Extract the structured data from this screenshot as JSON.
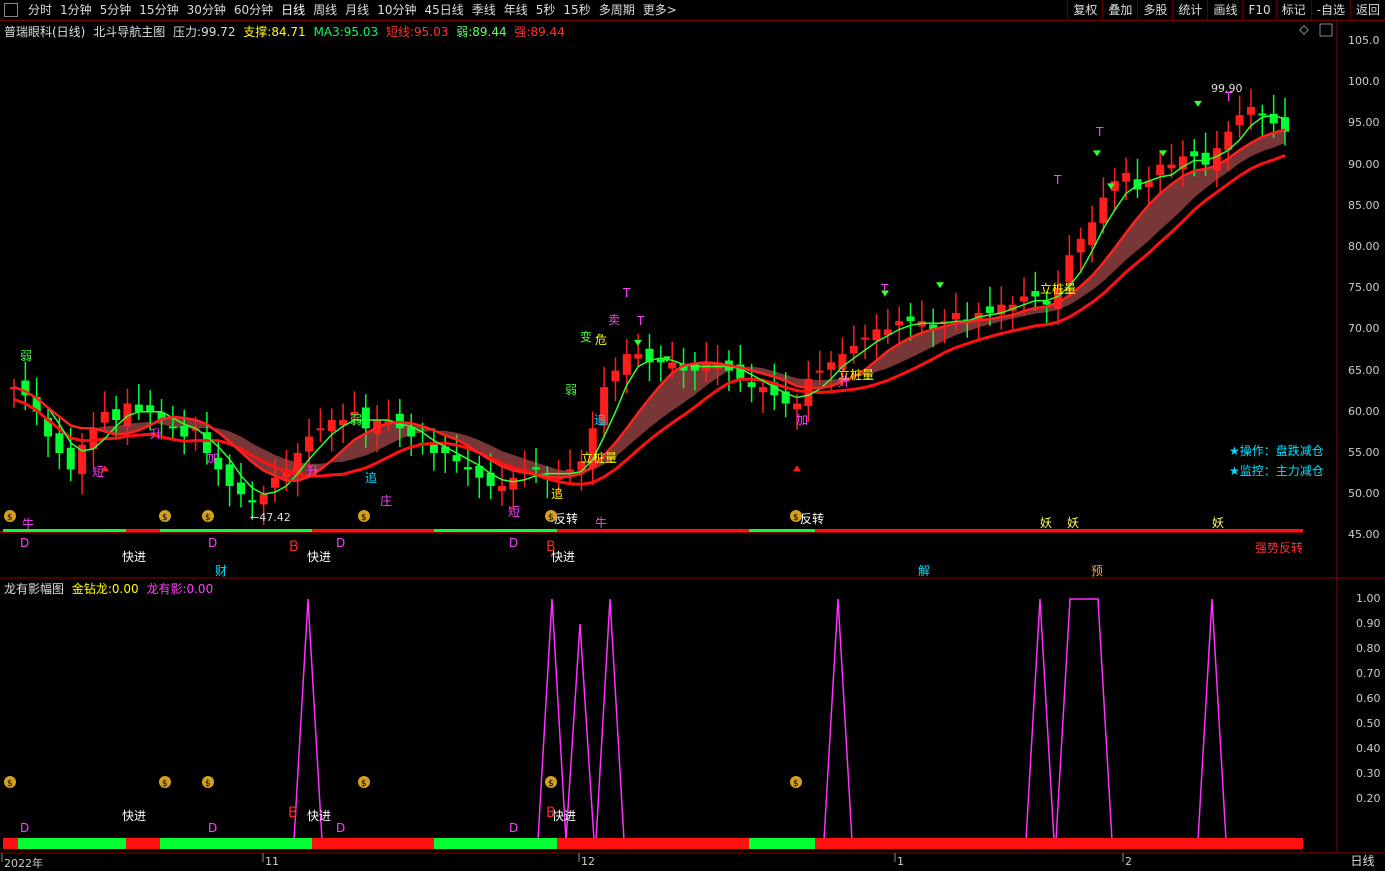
{
  "toolbar": {
    "timeframes": [
      "分时",
      "1分钟",
      "5分钟",
      "15分钟",
      "30分钟",
      "60分钟",
      "日线",
      "周线",
      "月线",
      "10分钟",
      "45日线",
      "季线",
      "年线",
      "5秒",
      "15秒",
      "多周期",
      "更多>"
    ],
    "active_index": 6,
    "right_tools": [
      "复权",
      "叠加",
      "多股",
      "统计",
      "画线",
      "F10",
      "标记",
      "-自选",
      "返回"
    ]
  },
  "main_panel": {
    "stock": "普瑞眼科(日线)",
    "indicator_name": "北斗导航主图",
    "pressure_label": "压力:",
    "pressure_value": "99.72",
    "support_label": "支撑:",
    "support_value": "84.71",
    "ma3_label": "MA3:",
    "ma3_value": "95.03",
    "short_label": "短线:",
    "short_value": "95.03",
    "weak_label": "弱:",
    "weak_value": "89.44",
    "strong_label": "强:",
    "strong_value": "89.44",
    "operation": "★操作：盘跌减仓",
    "monitor": "★监控：主力减仓",
    "strong_reversal": "强势反转",
    "high_mark": "99.90",
    "low_mark": "47.42",
    "price_axis": [
      "105.0",
      "100.0",
      "95.00",
      "90.00",
      "85.00",
      "80.00",
      "75.00",
      "70.00",
      "65.00",
      "60.00",
      "55.00",
      "50.00",
      "45.00"
    ],
    "labels": {
      "ruo1": "弱",
      "duan1": "短",
      "sheng1": "升",
      "jia1": "加",
      "ruo2": "弱",
      "zhui1": "追",
      "zhuang": "庄",
      "sheng2": "升",
      "duan2": "短",
      "zhui2": "追",
      "bian": "变",
      "wei": "危",
      "mai": "卖",
      "ruo3": "弱",
      "zhui3": "追",
      "li1": "立桩量",
      "li2": "立桩量",
      "li3": "立桩量",
      "jia2": "加",
      "sheng3": "升",
      "T": "T",
      "niu": "牛",
      "fanzhuan": "反转",
      "yao": "妖",
      "D": "D",
      "B": "B",
      "kuaijin": "快进",
      "cai": "财",
      "jie": "解",
      "yu": "预"
    }
  },
  "sub_panel": {
    "indicator_name": "龙有影幅图",
    "gold_label": "金钻龙:",
    "gold_value": "0.00",
    "dragon_label": "龙有影:",
    "dragon_value": "0.00",
    "axis": [
      "1.00",
      "0.90",
      "0.80",
      "0.70",
      "0.60",
      "0.50",
      "0.40",
      "0.30",
      "0.20"
    ],
    "labels": {
      "kuaijin": "快进",
      "D": "D",
      "B": "B"
    }
  },
  "dates": [
    "2022年",
    "11",
    "12",
    "1",
    "2"
  ],
  "bottom_tab": "日线",
  "colors": {
    "up": "#ff2020",
    "down": "#00ff40",
    "magenta": "#ff33ff",
    "accent_red": "#cc0000"
  }
}
